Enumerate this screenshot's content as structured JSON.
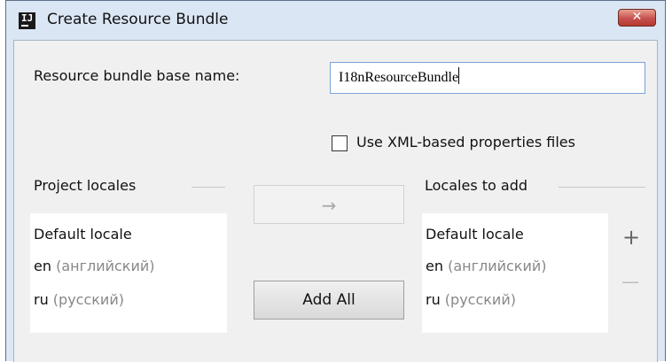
{
  "window": {
    "title": "Create Resource Bundle",
    "app_icon_text": "IJ",
    "close_glyph": "✕"
  },
  "form": {
    "base_name_label": "Resource bundle base name:",
    "base_name_value": "I18nResourceBundle",
    "xml_checkbox_label": "Use XML-based properties files",
    "xml_checkbox_checked": false
  },
  "project_locales": {
    "header": "Project locales",
    "items": [
      {
        "code": "Default locale",
        "native": ""
      },
      {
        "code": "en",
        "native": " (английский)"
      },
      {
        "code": "ru",
        "native": " (русский)"
      }
    ]
  },
  "locales_to_add": {
    "header": "Locales to add",
    "items": [
      {
        "code": "Default locale",
        "native": ""
      },
      {
        "code": "en",
        "native": " (английский)"
      },
      {
        "code": "ru",
        "native": " (русский)"
      }
    ]
  },
  "buttons": {
    "move_right_glyph": "→",
    "add_all_label": "Add All",
    "add_glyph": "+",
    "remove_glyph": "—"
  }
}
